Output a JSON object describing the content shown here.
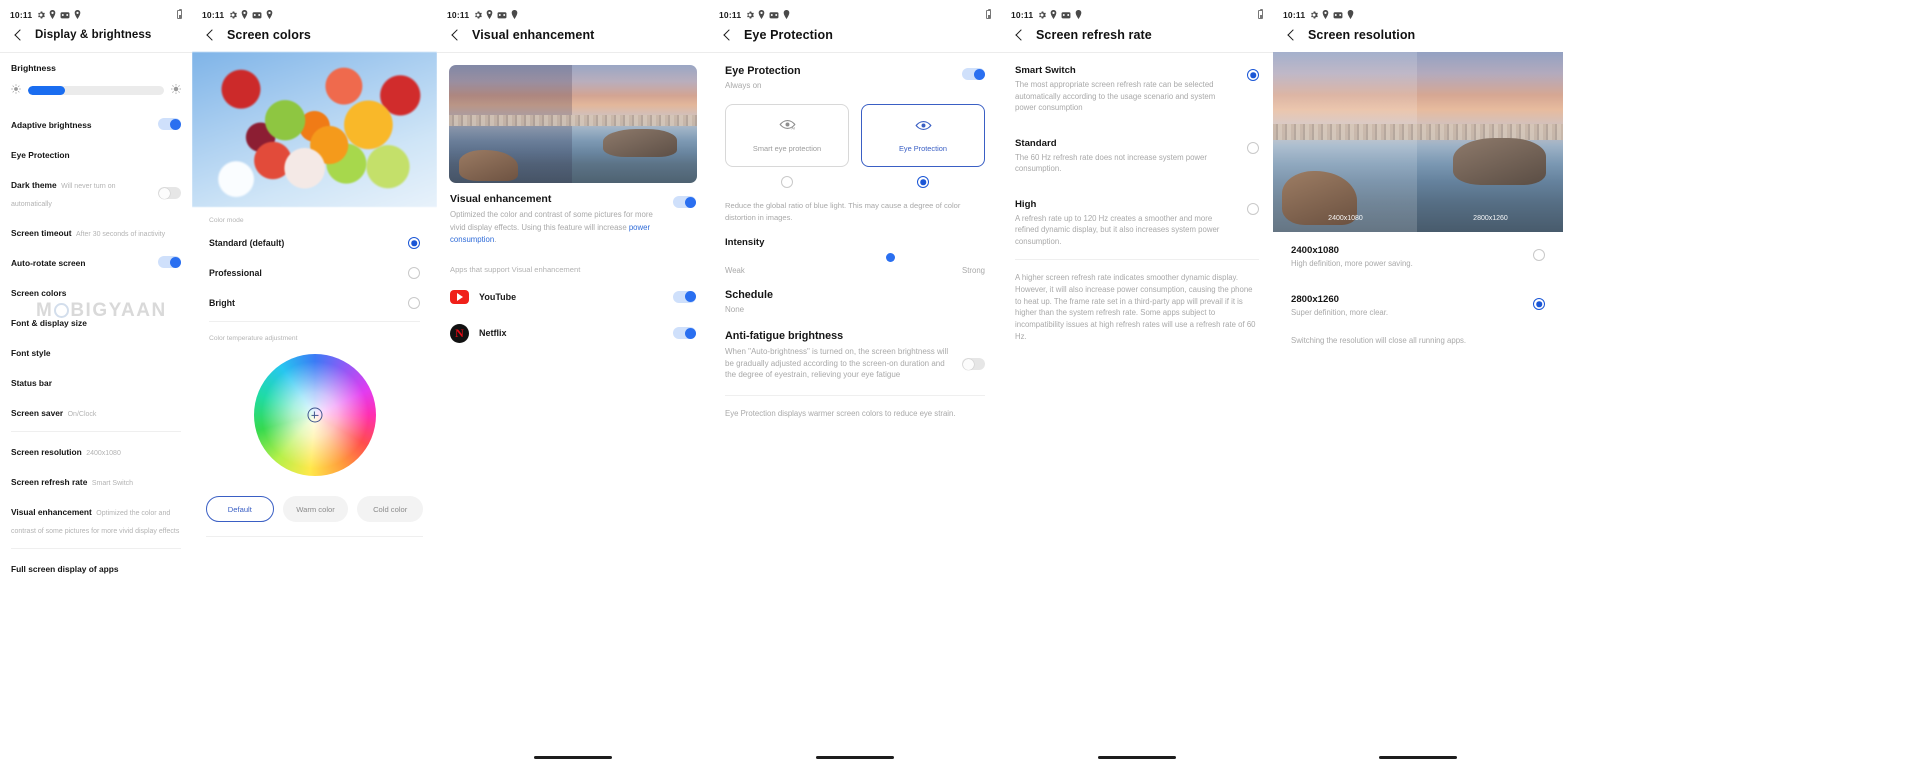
{
  "watermark": {
    "pre": "M",
    "post": "BIGYAAN"
  },
  "statusbar": {
    "time": "10:11"
  },
  "panel1": {
    "title": "Display & brightness",
    "brightness_label": "Brightness",
    "brightness_percent": 27,
    "rows": [
      {
        "title": "Adaptive brightness",
        "sub": "",
        "control": "switch-on"
      },
      {
        "title": "Eye Protection",
        "sub": "",
        "control": "none"
      },
      {
        "title": "Dark theme",
        "sub": "Will never turn on automatically",
        "control": "switch-off"
      },
      {
        "title": "Screen timeout",
        "sub": "After 30 seconds of inactivity",
        "control": "none"
      },
      {
        "title": "Auto-rotate screen",
        "sub": "",
        "control": "switch-on"
      },
      {
        "title": "Screen colors",
        "sub": "",
        "control": "none"
      },
      {
        "title": "Font & display size",
        "sub": "",
        "control": "none"
      },
      {
        "title": "Font style",
        "sub": "",
        "control": "none"
      },
      {
        "title": "Status bar",
        "sub": "",
        "control": "none"
      },
      {
        "title": "Screen saver",
        "sub": "On/Clock",
        "control": "none"
      }
    ],
    "rows2": [
      {
        "title": "Screen resolution",
        "sub": "2400x1080",
        "control": "none"
      },
      {
        "title": "Screen refresh rate",
        "sub": "Smart Switch",
        "control": "none"
      },
      {
        "title": "Visual enhancement",
        "sub": "Optimized the color and contrast of some pictures for more vivid display effects",
        "control": "none"
      }
    ],
    "rows3": [
      {
        "title": "Full screen display of apps",
        "sub": "",
        "control": "none"
      }
    ]
  },
  "panel2": {
    "title": "Screen colors",
    "group_label": "Color mode",
    "modes": [
      {
        "label": "Standard (default)",
        "selected": true
      },
      {
        "label": "Professional",
        "selected": false
      },
      {
        "label": "Bright",
        "selected": false
      }
    ],
    "temp_label": "Color temperature adjustment",
    "chips": [
      {
        "label": "Default",
        "selected": true
      },
      {
        "label": "Warm color",
        "selected": false
      },
      {
        "label": "Cold color",
        "selected": false
      }
    ]
  },
  "panel3": {
    "title": "Visual enhancement",
    "block_title": "Visual enhancement",
    "block_desc_1": "Optimized the color and contrast of some pictures for more vivid display effects. Using this feature will increase ",
    "block_desc_link": "power consumption",
    "block_desc_2": ".",
    "toggle_on": true,
    "apps_caption": "Apps that support Visual enhancement",
    "apps": [
      {
        "name": "YouTube",
        "icon": "youtube-icon",
        "enabled": true
      },
      {
        "name": "Netflix",
        "icon": "netflix-icon",
        "enabled": true
      }
    ]
  },
  "panel4": {
    "title": "Eye Protection",
    "head_title": "Eye Protection",
    "head_sub": "Always on",
    "cards": [
      {
        "label": "Smart eye protection",
        "icon": "eye-ai-icon",
        "selected": false
      },
      {
        "label": "Eye Protection",
        "icon": "eye-icon",
        "selected": true
      }
    ],
    "note": "Reduce the global ratio of blue light. This may cause a degree of color distortion in images.",
    "intensity_label": "Intensity",
    "intensity_percent": 62,
    "weak_label": "Weak",
    "strong_label": "Strong",
    "schedule_title": "Schedule",
    "schedule_value": "None",
    "antifatigue_title": "Anti-fatigue brightness",
    "antifatigue_desc": "When \"Auto-brightness\" is turned on, the screen brightness will be gradually adjusted according to the screen-on duration and the degree of eyestrain, relieving your eye fatigue",
    "antifatigue_on": false,
    "footnote": "Eye Protection displays warmer screen colors to reduce eye strain."
  },
  "panel5": {
    "title": "Screen refresh rate",
    "options": [
      {
        "title": "Smart Switch",
        "desc": "The most appropriate screen refresh rate can be selected automatically according to the usage scenario and system power consumption",
        "selected": true
      },
      {
        "title": "Standard",
        "desc": "The 60 Hz refresh rate does not increase system power consumption.",
        "selected": false
      },
      {
        "title": "High",
        "desc": "A refresh rate up to 120 Hz creates a smoother and more refined dynamic display, but it also increases system power consumption.",
        "selected": false
      }
    ],
    "longnote": "A higher screen refresh rate indicates smoother dynamic display. However, it will also increase power consumption, causing the phone to heat up. The frame rate set in a third-party app will prevail if it is higher than the system refresh rate. Some apps subject to incompatibility issues at high refresh rates will use a refresh rate of 60 Hz."
  },
  "panel6": {
    "title": "Screen resolution",
    "image_tag_left": "2400x1080",
    "image_tag_right": "2800x1260",
    "options": [
      {
        "title": "2400x1080",
        "desc": "High definition, more power saving.",
        "selected": false
      },
      {
        "title": "2800x1260",
        "desc": "Super definition, more clear.",
        "selected": true
      }
    ],
    "foot": "Switching the resolution will close all running apps."
  }
}
